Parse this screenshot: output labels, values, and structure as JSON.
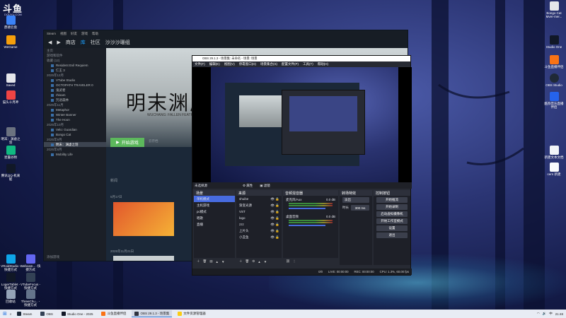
{
  "branding": {
    "logo": "斗鱼",
    "logo_sub": "DOUYU.COM"
  },
  "desktop_left": [
    {
      "label": "鼎德云盘",
      "color": "#3b82f6"
    },
    {
      "label": "WeGame",
      "color": "#f59e0b"
    },
    {
      "label": "Saved",
      "color": "#e5e7eb"
    },
    {
      "label": "猫头十月神",
      "color": "#ef4444"
    },
    {
      "label": "明末：渊虚之羽",
      "color": "#6b7280"
    },
    {
      "label": "星露谷物",
      "color": "#10b981"
    },
    {
      "label": "腾讯QQ-机来能",
      "color": "#111827"
    },
    {
      "label": "VRoidStudio -快捷方式",
      "color": "#0ea5e9"
    },
    {
      "label": "Webcam... -快捷方式",
      "color": "#6366f1"
    },
    {
      "label": "LogerTablet -快捷方式",
      "color": "#111827"
    },
    {
      "label": "VTubeFocus -快捷方式",
      "color": "#334155"
    },
    {
      "label": "回收站",
      "color": "#94a3b8"
    },
    {
      "label": "ThreeChu... -快捷方式",
      "color": "#64748b"
    }
  ],
  "desktop_right": [
    {
      "label": "Bongo Cat Mver-mer...",
      "color": "#e5e7eb"
    },
    {
      "label": "Studio One",
      "color": "#111827"
    },
    {
      "label": "斗鱼直播伴侣",
      "color": "#f97316"
    },
    {
      "label": "OBS Studio",
      "color": "#1f2937"
    },
    {
      "label": "酷狗音乐直播伴侣",
      "color": "#2563eb"
    },
    {
      "label": "新建文本文档",
      "color": "#f1f5f9"
    },
    {
      "label": "cern 新建",
      "color": "#f8fafc"
    }
  ],
  "steam": {
    "menu": [
      "Steam",
      "视图",
      "好友",
      "游戏",
      "帮助"
    ],
    "nav": [
      "商店",
      "库",
      "社区",
      "沙沙沙珊组"
    ],
    "home": "主页",
    "filter": "游戏和软件",
    "library": [
      {
        "text": "收藏 (12)",
        "hdr": true
      },
      {
        "text": "Resident Evil Requiem",
        "hdr": false
      },
      {
        "text": "仁王 3",
        "hdr": false
      },
      {
        "text": "2025年12月",
        "hdr": true
      },
      {
        "text": "VTube Studio",
        "hdr": false
      },
      {
        "text": "OCTOPATH TRAVELER 0",
        "hdr": false
      },
      {
        "text": "鬼武者",
        "hdr": false
      },
      {
        "text": "rhisam",
        "hdr": false
      },
      {
        "text": "咒语森林",
        "hdr": false
      },
      {
        "text": "2025年11月",
        "hdr": true
      },
      {
        "text": "Metaphor",
        "hdr": false
      },
      {
        "text": "Winter Banner",
        "hdr": false
      },
      {
        "text": "The Hoon",
        "hdr": false
      },
      {
        "text": "2025年10月",
        "hdr": true
      },
      {
        "text": "Velo: Guardian",
        "hdr": false
      },
      {
        "text": "Bongo Cat",
        "hdr": false
      },
      {
        "text": "2025年9月",
        "hdr": true
      },
      {
        "text": "明末：渊虚之羽",
        "hdr": false,
        "sel": true
      },
      {
        "text": "2025年8月",
        "hdr": true
      },
      {
        "text": "Mobility Life",
        "hdr": false
      }
    ],
    "add_game": "添加游戏",
    "game_title": "明末渊虚",
    "game_sub": "WUCHANG: FALLEN FEATHERS",
    "play_label": "开始游戏",
    "cloud_label": "云存档",
    "news": "新闻",
    "date1": "5月17日",
    "date2": "2025年11月21日"
  },
  "obs": {
    "title": "OBS 29.1.3 - 场景集: 未命名 - 场景: 场景",
    "menu": [
      "文件(F)",
      "编辑(E)",
      "视图(V)",
      "停靠窗口(D)",
      "场景集合(S)",
      "配置文件(P)",
      "工具(T)",
      "帮助(H)"
    ],
    "scene_bar_label": "未选择源",
    "props": "属性",
    "filters": "滤镜",
    "scenes_title": "场景",
    "scenes": [
      "单机模式",
      "主机游戏",
      "pc模式",
      "唱歌",
      "直播"
    ],
    "sources_title": "来源",
    "sources": [
      "shuibe",
      "渐变光源",
      "VST",
      "logo",
      "zzz",
      "上片头",
      "小丑鱼"
    ],
    "mixer_title": "音频混音器",
    "mixer": [
      {
        "name": "麦克风/Aux",
        "db": "0.0 dB"
      },
      {
        "name": "桌面音频",
        "db": "0.0 dB"
      }
    ],
    "transition_title": "转场特效",
    "transition": "淡出",
    "duration_label": "时长",
    "duration": "300 ms",
    "controls_title": "控制按钮",
    "controls": [
      "开始推流",
      "开始录制",
      "启动虚拟摄像机",
      "开始工作室模式",
      "设置",
      "退出"
    ],
    "status": {
      "live": "LIVE: 00:00:00",
      "rec": "REC: 00:00:00",
      "cpu": "CPU: 1.3%, 60.00 fps",
      "dropped": "0/0"
    }
  },
  "taskbar": {
    "items": [
      {
        "label": "Steam",
        "color": "#1b2838",
        "active": false
      },
      {
        "label": "OBS",
        "color": "#334155",
        "active": false
      },
      {
        "label": "Studio One - 2025",
        "color": "#111827",
        "active": false
      },
      {
        "label": "斗鱼直播伴侣",
        "color": "#f97316",
        "active": false
      },
      {
        "label": "OBS 29.1.3 - 场景集",
        "color": "#2f3340",
        "active": true
      },
      {
        "label": "文件资源管理器",
        "color": "#facc15",
        "active": false
      }
    ],
    "time": "21:48",
    "lang": "中"
  }
}
